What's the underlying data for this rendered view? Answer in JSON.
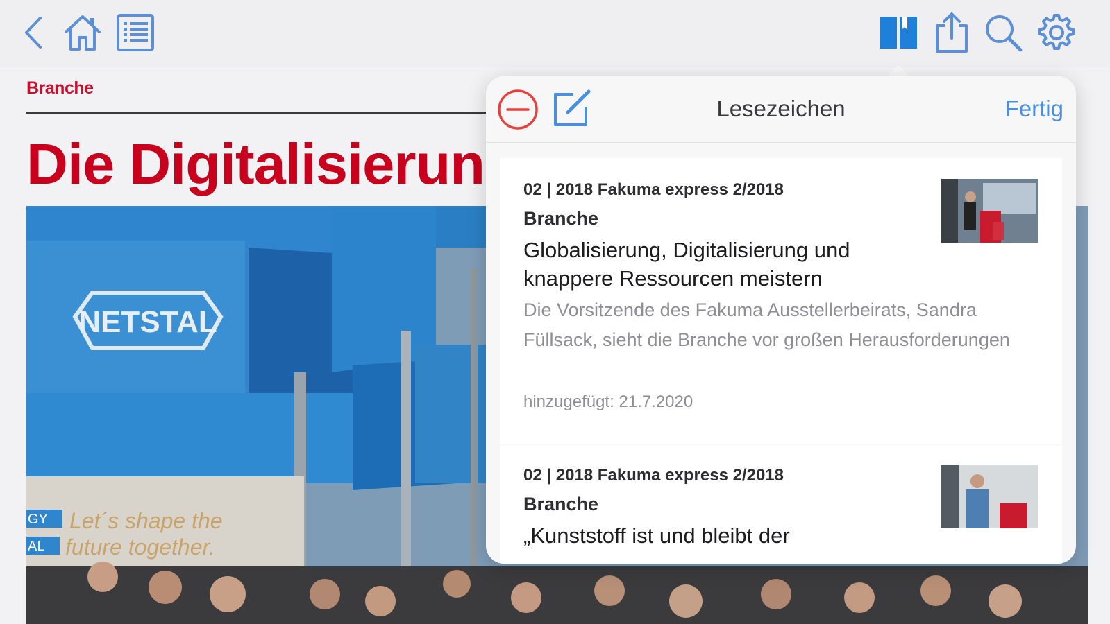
{
  "toolbar": {
    "icons": [
      "back-icon",
      "home-icon",
      "contents-list-icon",
      "bookmarks-icon",
      "share-icon",
      "search-icon",
      "settings-icon"
    ],
    "active_color": "#1f7fd9",
    "icon_color": "#5b8fd6"
  },
  "article": {
    "section": "Branche",
    "headline": "Die Digitalisierung",
    "photo": {
      "booth_logo": "NETSTAL",
      "slogan_line1": "Let´s shape the",
      "slogan_line2": "future together.",
      "side_text_1": "GY",
      "side_text_2": "AL"
    }
  },
  "popover": {
    "title": "Lesezeichen",
    "done_label": "Fertig",
    "bookmarks": [
      {
        "meta": "02 | 2018 Fakuma express 2/2018",
        "category": "Branche",
        "title": "Globalisierung, Digitalisierung und knappere Ressourcen meistern",
        "description": "Die Vorsitzende des Fakuma Ausstellerbeirats, Sandra Füllsack, sieht die Branche vor großen Herausforderungen",
        "added": "hinzugefügt: 21.7.2020"
      },
      {
        "meta": "02 | 2018 Fakuma express 2/2018",
        "category": "Branche",
        "title": "„Kunststoff ist und bleibt der"
      }
    ]
  },
  "colors": {
    "brand_red": "#c8001e",
    "link_blue": "#4a90e2",
    "delete_red": "#e8413c"
  }
}
